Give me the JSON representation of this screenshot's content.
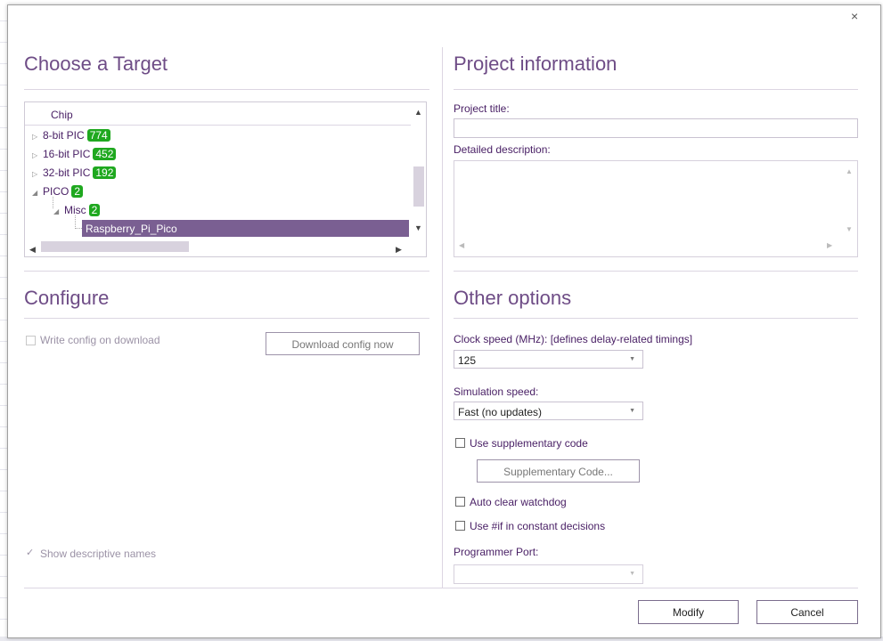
{
  "dialog": {
    "close_glyph": "×"
  },
  "target": {
    "heading": "Choose a Target",
    "tree_header": "Chip",
    "items": [
      {
        "label": "8-bit PIC",
        "count": "774",
        "expander": "▷"
      },
      {
        "label": "16-bit PIC",
        "count": "452",
        "expander": "▷"
      },
      {
        "label": "32-bit PIC",
        "count": "192",
        "expander": "▷"
      },
      {
        "label": "PICO",
        "count": "2",
        "expander": "◢"
      },
      {
        "label": "Misc",
        "count": "2",
        "expander": "◢"
      }
    ],
    "selected_chip": "Raspberry_Pi_Pico",
    "badge_color": "#1fa81f"
  },
  "configure": {
    "heading": "Configure",
    "write_config_label": "Write config on download",
    "download_button": "Download config now",
    "show_descriptive_label": "Show descriptive names"
  },
  "project": {
    "heading": "Project information",
    "title_label": "Project title:",
    "title_value": "",
    "description_label": "Detailed description:",
    "description_value": ""
  },
  "options": {
    "heading": "Other options",
    "clock_label": "Clock speed (MHz): [defines delay-related timings]",
    "clock_value": "125",
    "sim_label": "Simulation speed:",
    "sim_value": "Fast (no updates)",
    "use_supplementary_label": "Use supplementary code",
    "supplementary_button": "Supplementary Code...",
    "auto_clear_label": "Auto clear watchdog",
    "use_if_label": "Use #if in constant decisions",
    "programmer_port_label": "Programmer Port:",
    "programmer_port_value": ""
  },
  "footer": {
    "modify_button": "Modify",
    "cancel_button": "Cancel"
  },
  "colors": {
    "accent": "#7a5f92",
    "heading": "#6e4c86",
    "label": "#4a2166"
  }
}
